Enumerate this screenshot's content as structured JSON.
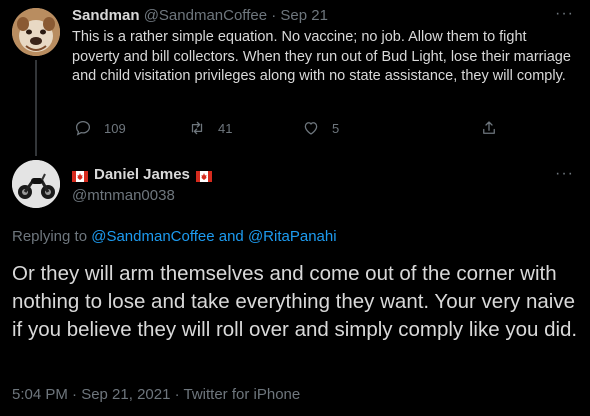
{
  "parent_tweet": {
    "display_name": "Sandman",
    "handle": "@SandmanCoffee",
    "separator": "·",
    "date": "Sep 21",
    "text": "This is a rather simple equation. No vaccine; no job. Allow them to fight poverty and bill collectors. When they run out of Bud Light, lose their marriage and child visitation privileges along with no state assistance, they will comply.",
    "reply_count": "109",
    "retweet_count": "41",
    "like_count": "5",
    "more_icon": "more-horizontal-icon"
  },
  "main_tweet": {
    "display_name": "Daniel James",
    "handle": "@mtnman0038",
    "flag_icon": "canada-flag-icon",
    "replying_prefix": "Replying to",
    "replying_to": "@SandmanCoffee and @RitaPanahi",
    "text": "Or they will arm themselves and come out of the corner with nothing to lose and take everything they want. Your very naive if you believe they will roll over and simply comply like you did.",
    "timestamp": "5:04 PM · Sep 21, 2021 · Twitter for iPhone"
  },
  "colors": {
    "background": "#000000",
    "text": "#d9d9d9",
    "muted": "#6e767d",
    "link": "#1d9bf0",
    "flag_red": "#d52b1e"
  }
}
